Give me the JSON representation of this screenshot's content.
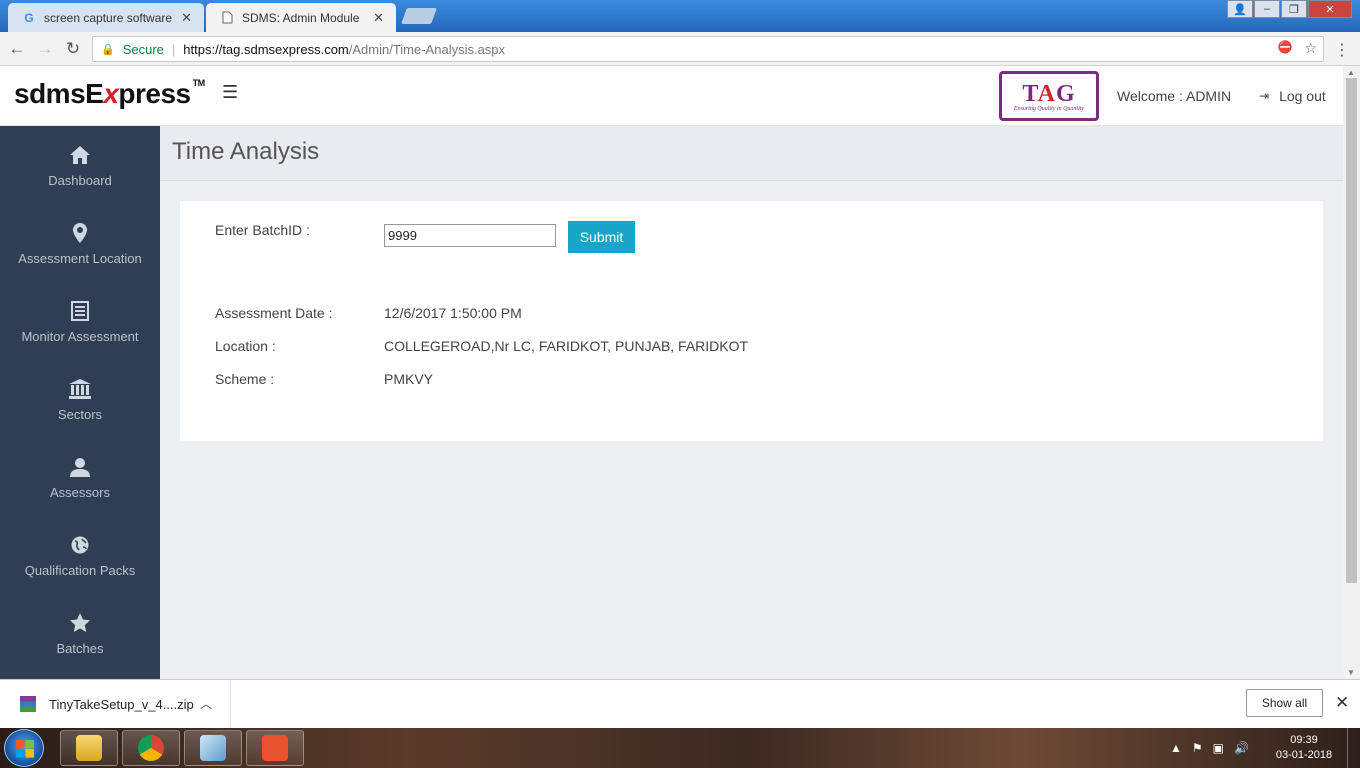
{
  "browser": {
    "tabs": [
      {
        "label": "screen capture software",
        "icon": "google-g-icon",
        "active": false
      },
      {
        "label": "SDMS: Admin Module",
        "icon": "page-icon",
        "active": true
      }
    ],
    "secure_label": "Secure",
    "url_host": "https://tag.sdmsexpress.com",
    "url_path": "/Admin/Time-Analysis.aspx"
  },
  "header": {
    "logo_text": "sdmsE",
    "logo_x": "x",
    "logo_rest": "press",
    "logo_tm": "TM",
    "tag_logo_t": "T",
    "tag_logo_a": "A",
    "tag_logo_g": "G",
    "tag_tagline": "Ensuring Quality in Quantity",
    "welcome": "Welcome : ADMIN",
    "logout": "Log out"
  },
  "sidebar": {
    "items": [
      {
        "label": "Dashboard",
        "icon": "home-icon"
      },
      {
        "label": "Assessment Location",
        "icon": "map-marker-icon"
      },
      {
        "label": "Monitor Assessment",
        "icon": "list-icon"
      },
      {
        "label": "Sectors",
        "icon": "bank-icon"
      },
      {
        "label": "Assessors",
        "icon": "user-icon"
      },
      {
        "label": "Qualification Packs",
        "icon": "globe-icon"
      },
      {
        "label": "Batches",
        "icon": "star-icon"
      }
    ]
  },
  "main": {
    "title": "Time Analysis",
    "batch_label": "Enter BatchID :",
    "batch_value": "9999",
    "submit_label": "Submit",
    "details": [
      {
        "label": "Assessment Date :",
        "value": "12/6/2017 1:50:00 PM"
      },
      {
        "label": "Location :",
        "value": "COLLEGEROAD,Nr LC, FARIDKOT, PUNJAB, FARIDKOT"
      },
      {
        "label": "Scheme :",
        "value": "PMKVY"
      }
    ]
  },
  "downloads": {
    "file": "TinyTakeSetup_v_4....zip",
    "show_all": "Show all"
  },
  "taskbar": {
    "time": "09:39",
    "date": "03-01-2018"
  },
  "colors": {
    "sidebar_bg": "#2f3e53",
    "submit_bg": "#17a6c8",
    "tag_purple": "#7c2a7e",
    "logo_red": "#d81e25"
  }
}
